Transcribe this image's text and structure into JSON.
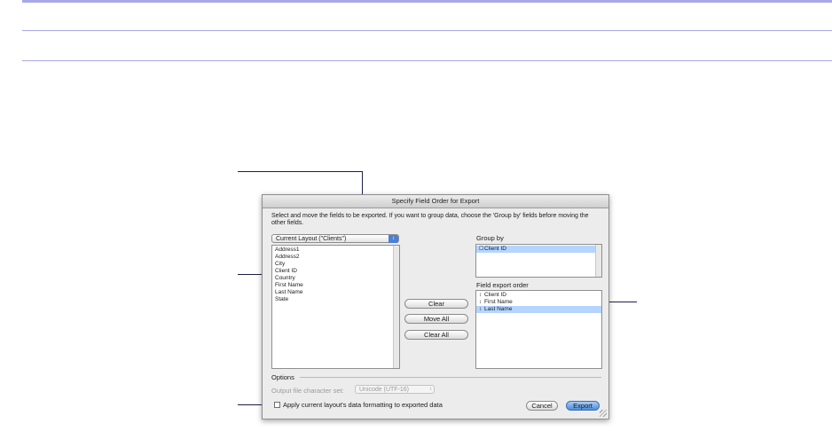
{
  "dialog": {
    "title": "Specify Field Order for Export",
    "instructions": "Select and move the fields to be exported.  If you want to group data, choose the 'Group by' fields before moving the\nother fields.",
    "layout_popup_value": "Current Layout (\"Clients\")",
    "available_fields": [
      "Address1",
      "Address2",
      "City",
      "Client ID",
      "Country",
      "First Name",
      "Last Name",
      "State"
    ],
    "group_by_label": "Group by",
    "group_by_items": [
      {
        "label": "Client ID",
        "selected": true
      }
    ],
    "field_export_order_label": "Field export order",
    "field_export_order": [
      {
        "label": "Client ID",
        "selected": false
      },
      {
        "label": "First Name",
        "selected": false
      },
      {
        "label": "Last Name",
        "selected": true
      }
    ],
    "buttons": {
      "clear": "Clear",
      "move_all": "Move All",
      "clear_all": "Clear All",
      "cancel": "Cancel",
      "export": "Export"
    },
    "options_label": "Options",
    "charset_label": "Output file character set:",
    "charset_value": "Unicode (UTF-16)",
    "apply_formatting_label": "Apply current layout's data formatting to exported data",
    "apply_formatting_checked": false
  },
  "colors": {
    "rule": "#a9a8e6",
    "callout": "#1e1e4a",
    "selection": "#b5d5ff",
    "default_button": "#4b8ddb"
  }
}
